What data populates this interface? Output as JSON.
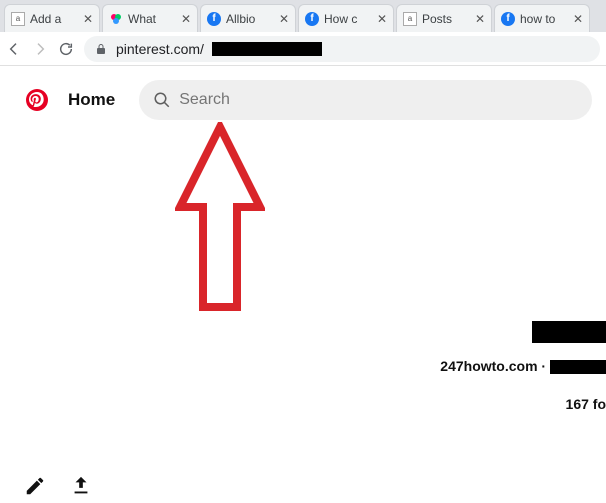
{
  "browser": {
    "tabs": [
      {
        "title": "Add a"
      },
      {
        "title": "What"
      },
      {
        "title": "Allbio"
      },
      {
        "title": "How c"
      },
      {
        "title": "Posts"
      },
      {
        "title": "how to"
      }
    ],
    "url_visible": "pinterest.com/"
  },
  "page": {
    "home_label": "Home",
    "search_placeholder": "Search",
    "profile_domain": "247howto.com",
    "profile_separator": " · ",
    "follow_text": "167 fo"
  }
}
